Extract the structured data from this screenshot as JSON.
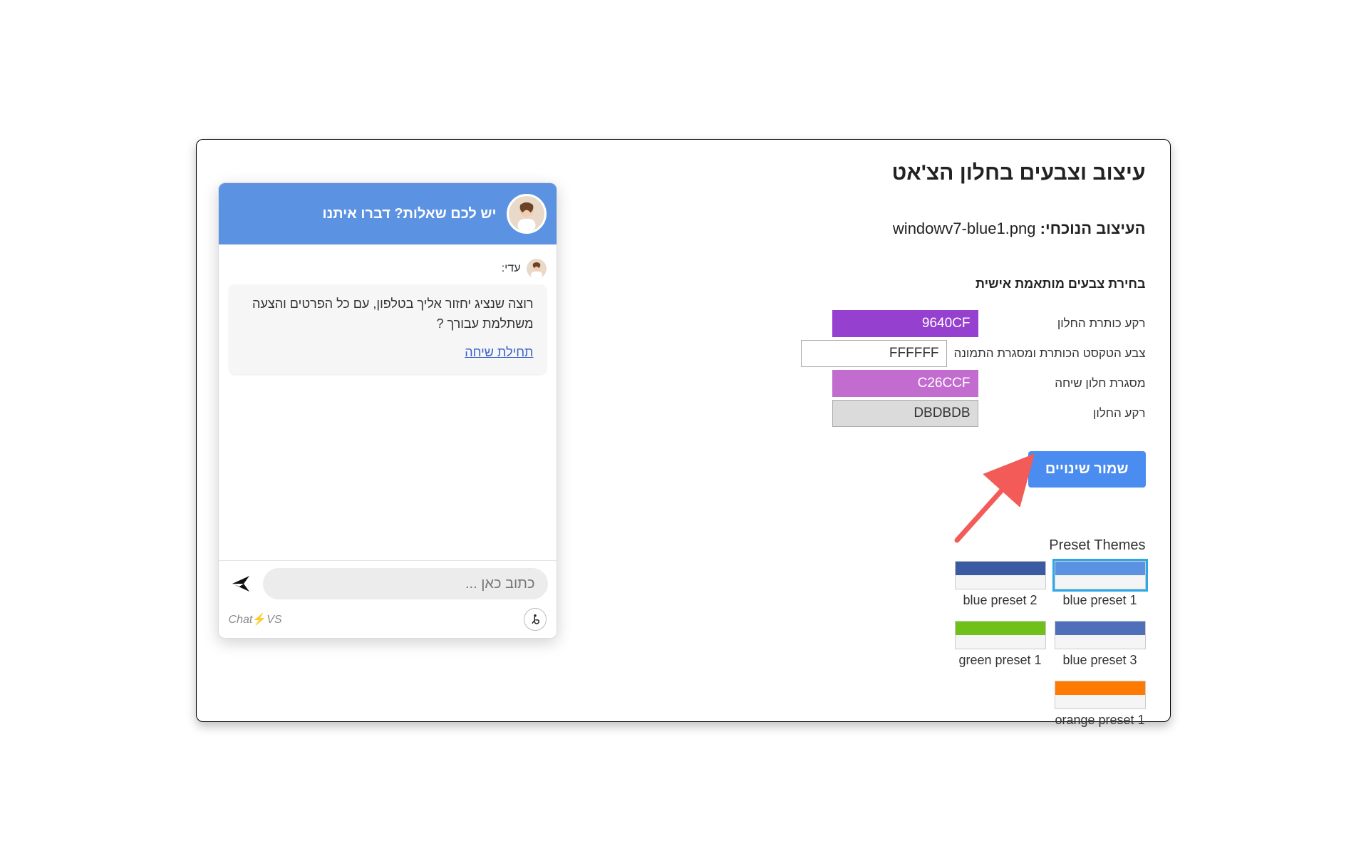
{
  "title": "עיצוב וצבעים בחלון הצ'אט",
  "current_design": {
    "label": "העיצוב הנוכחי:",
    "file": "windowv7-blue1.png"
  },
  "personal_colors_heading": "בחירת צבעים מותאמת אישית",
  "colors": [
    {
      "label": "רקע כותרת החלון",
      "value": "9640CF",
      "bg": "#9640CF",
      "text_color": "#fff"
    },
    {
      "label": "צבע הטקסט הכותרת ומסגרת התמונה",
      "value": "FFFFFF",
      "bg": "#FFFFFF",
      "text_color": "#333"
    },
    {
      "label": "מסגרת חלון שיחה",
      "value": "C26CCF",
      "bg": "#C26CCF",
      "text_color": "#fff"
    },
    {
      "label": "רקע החלון",
      "value": "DBDBDB",
      "bg": "#DBDBDB",
      "text_color": "#333"
    }
  ],
  "save_button": "שמור שינויים",
  "presets": {
    "title": "Preset Themes",
    "items": [
      {
        "label": "blue preset 1",
        "color": "#5b92e2",
        "selected": true
      },
      {
        "label": "blue preset 2",
        "color": "#3a5aa2",
        "selected": false
      },
      {
        "label": "blue preset 3",
        "color": "#4f6fb8",
        "selected": false
      },
      {
        "label": "green preset 1",
        "color": "#6fc11a",
        "selected": false
      },
      {
        "label": "orange preset 1",
        "color": "#ff7a00",
        "selected": false
      }
    ]
  },
  "chat": {
    "header_text": "יש לכם שאלות? דברו איתנו",
    "author_name": "עדי:",
    "message": "רוצה שנציג יחזור אליך בטלפון, עם כל הפרטים והצעה משתלמת עבורך ?",
    "start_chat": "תחילת שיחה",
    "input_placeholder": "כתוב כאן ...",
    "brand_chat": "Chat",
    "brand_vs": "VS"
  }
}
